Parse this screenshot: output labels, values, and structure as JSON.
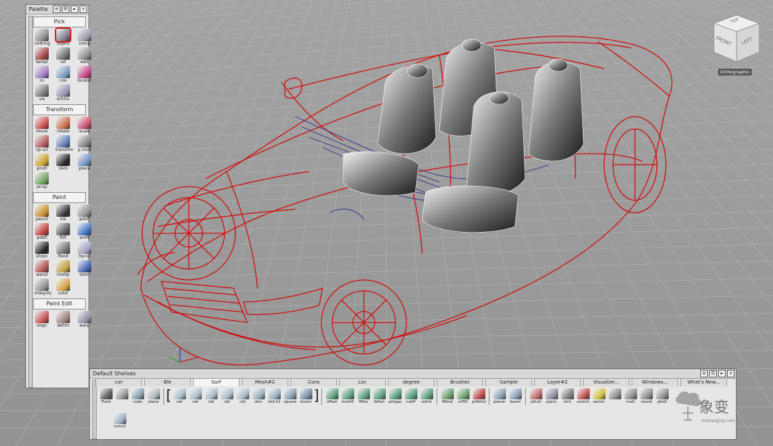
{
  "viewcube": {
    "top": "TOP",
    "front": "FRONT",
    "left": "LEFT",
    "projection": "Orthographic"
  },
  "palette": {
    "title": "Palette",
    "sections": [
      {
        "label": "Pick",
        "tools": [
          {
            "label": "nothing",
            "icon": "pick-nothing-icon",
            "color": "#8a8a8a"
          },
          {
            "label": "object",
            "icon": "pick-object-icon",
            "color": "#7a7a8c",
            "selected": true
          },
          {
            "label": "comp",
            "icon": "pick-component-icon",
            "color": "#9a9aa8"
          },
          {
            "label": "templ",
            "icon": "pick-template-icon",
            "color": "#a04040"
          },
          {
            "label": "ref",
            "icon": "pick-reference-icon",
            "color": "#6a6a6a"
          },
          {
            "label": "edit",
            "icon": "pick-edit-icon",
            "color": "#8c8c8c"
          },
          {
            "label": "cv",
            "icon": "pick-cv-icon",
            "color": "#9c7ac0"
          },
          {
            "label": "cos",
            "icon": "pick-cos-icon",
            "color": "#7a9ac0"
          },
          {
            "label": "locator",
            "icon": "pick-locator-icon",
            "color": "#c04080"
          },
          {
            "label": "vis",
            "icon": "pick-visible-icon",
            "color": "#777777"
          },
          {
            "label": "srfchn",
            "icon": "pick-surface-chain-icon",
            "color": "#9090b0"
          }
        ]
      },
      {
        "label": "Transform",
        "tools": [
          {
            "label": "move",
            "icon": "move-icon",
            "color": "#c84a4a"
          },
          {
            "label": "rotate",
            "icon": "rotate-icon",
            "color": "#c86a4a"
          },
          {
            "label": "scale",
            "icon": "scale-icon",
            "color": "#c84a6a"
          },
          {
            "label": "np scl",
            "icon": "nonproportional-scale-icon",
            "color": "#b05a5a"
          },
          {
            "label": "transfrm",
            "icon": "transform-icon",
            "color": "#5a7ab0"
          },
          {
            "label": "p mod",
            "icon": "pivot-modify-icon",
            "color": "#808080"
          },
          {
            "label": "pivot",
            "icon": "pivot-icon",
            "color": "#c8a030"
          },
          {
            "label": "zero",
            "icon": "zero-icon",
            "color": "#222222"
          },
          {
            "label": "place",
            "icon": "place-icon",
            "color": "#7090c0"
          },
          {
            "label": "array",
            "icon": "array-icon",
            "color": "#6aa060"
          }
        ]
      },
      {
        "label": "Paint",
        "tools": [
          {
            "label": "pencil",
            "icon": "pencil-icon",
            "color": "#c89030"
          },
          {
            "label": "ink",
            "icon": "ink-icon",
            "color": "#303030"
          },
          {
            "label": "airbft",
            "icon": "airbrush-icon",
            "color": "#909090"
          },
          {
            "label": "pdsft",
            "icon": "paint-soft-icon",
            "color": "#c04040"
          },
          {
            "label": "fblt",
            "icon": "felt-pen-icon",
            "color": "#555555"
          },
          {
            "label": "ersft",
            "icon": "eraser-icon",
            "color": "#4070c0"
          },
          {
            "label": "shrpn",
            "icon": "sharpen-icon",
            "color": "#202020"
          },
          {
            "label": "flood",
            "icon": "flood-fill-icon",
            "color": "#707070"
          },
          {
            "label": "bycol",
            "icon": "by-color-icon",
            "color": "#a0a0c0"
          },
          {
            "label": "wand",
            "icon": "magic-wand-icon",
            "color": "#b05050"
          },
          {
            "label": "imshp",
            "icon": "image-shape-icon",
            "color": "#c0a040"
          },
          {
            "label": "txtm",
            "icon": "text-icon",
            "color": "#4060b0"
          },
          {
            "label": "mdsymc",
            "icon": "mirror-symmetry-icon",
            "color": "#909090"
          },
          {
            "label": "color",
            "icon": "color-wheel-icon",
            "color": "#d0a040"
          }
        ]
      },
      {
        "label": "Paint Edit",
        "tools": [
          {
            "label": "xlayr",
            "icon": "transform-layer-icon",
            "color": "#c05050"
          },
          {
            "label": "defrm",
            "icon": "deform-icon",
            "color": "#a08080"
          },
          {
            "label": "warp",
            "icon": "warp-icon",
            "color": "#9090a0"
          }
        ]
      }
    ]
  },
  "shelves": {
    "title": "Default Shelves",
    "tabs": [
      "cur",
      "Ble",
      "Surf",
      "Mesh#2",
      "Cons",
      "Loc",
      "degree",
      "Brushes",
      "Sample",
      "Layer#2",
      "Visualize...",
      "Windows...",
      "What's New..."
    ],
    "active_tab": "Surf",
    "left_tools": [
      {
        "label": "Trash",
        "icon": "trash-icon",
        "color": "#606060"
      },
      {
        "label": "",
        "icon": "arrow-right-icon",
        "color": "#999999"
      },
      {
        "label": "cube",
        "icon": "cube-icon",
        "color": "#8aa0b0"
      },
      {
        "label": "plane",
        "icon": "plane-icon",
        "color": "#b0b8c0"
      }
    ],
    "rail_tools": [
      {
        "label": "rail",
        "icon": "rail-surface-icon",
        "color": "#a8bcc8"
      },
      {
        "label": "rail",
        "icon": "rail-surface-icon",
        "color": "#a8bcc8"
      },
      {
        "label": "rail",
        "icon": "rail-surface-icon",
        "color": "#a8bcc8"
      },
      {
        "label": "rail",
        "icon": "rail-surface-icon",
        "color": "#a8bcc8"
      },
      {
        "label": "rail",
        "icon": "rail-surface-icon",
        "color": "#a8bcc8"
      },
      {
        "label": "skin",
        "icon": "skin-icon",
        "color": "#9ab0c0"
      },
      {
        "label": "skin12",
        "icon": "skin-icon",
        "color": "#9ab0c0"
      },
      {
        "label": "square",
        "icon": "square-surface-icon",
        "color": "#8aa0b8"
      },
      {
        "label": "revolv",
        "icon": "revolve-icon",
        "color": "#7a90a8"
      }
    ],
    "edit_tools": [
      {
        "label": "offset",
        "icon": "offset-icon",
        "color": "#60a080"
      },
      {
        "label": "msdrft",
        "icon": "draft-icon",
        "color": "#60a080"
      },
      {
        "label": "flflan",
        "icon": "flange-icon",
        "color": "#60a080"
      },
      {
        "label": "tbflan",
        "icon": "tube-flange-icon",
        "color": "#60a080"
      },
      {
        "label": "pnlgap",
        "icon": "panel-gap-icon",
        "color": "#60a080"
      },
      {
        "label": "rubff",
        "icon": "round-off-icon",
        "color": "#60a080"
      },
      {
        "label": "extrd",
        "icon": "extrude-icon",
        "color": "#60a080"
      }
    ],
    "blend_tools": [
      {
        "label": "ffblnd",
        "icon": "freeform-blend-icon",
        "color": "#70a070"
      },
      {
        "label": "srflllt",
        "icon": "surface-fillet-icon",
        "color": "#70a070"
      },
      {
        "label": "prfblnd",
        "icon": "profile-blend-icon",
        "color": "#c05050"
      }
    ],
    "misc_tools": [
      {
        "label": "planar",
        "icon": "planar-icon",
        "color": "#8aa0b8"
      },
      {
        "label": "bevel",
        "icon": "bevel-icon",
        "color": "#8aa0b8"
      }
    ],
    "right_tools": [
      {
        "label": "plhull",
        "icon": "hull-icon",
        "color": "#c07070"
      },
      {
        "label": "pqrsc",
        "icon": "pqr-icon",
        "color": "#9090a0"
      },
      {
        "label": "stch",
        "icon": "stitch-icon",
        "color": "#808080"
      },
      {
        "label": "unstch",
        "icon": "unstitch-icon",
        "color": "#c05050"
      },
      {
        "label": "sector",
        "icon": "sector-icon",
        "color": "#d0c040"
      },
      {
        "label": "",
        "icon": "stack-icon",
        "color": "#909090"
      },
      {
        "label": "rnalt",
        "icon": "round-icon",
        "color": "#909090"
      },
      {
        "label": "round",
        "icon": "round-icon",
        "color": "#909090"
      },
      {
        "label": "pbd2",
        "icon": "patch-icon",
        "color": "#909090"
      }
    ],
    "row2_tools": [
      {
        "label": "trmcrf",
        "icon": "trim-convert-icon",
        "color": "#a0b0c0"
      }
    ]
  },
  "watermark": {
    "cn": "象变",
    "url": "mohanging.com"
  }
}
